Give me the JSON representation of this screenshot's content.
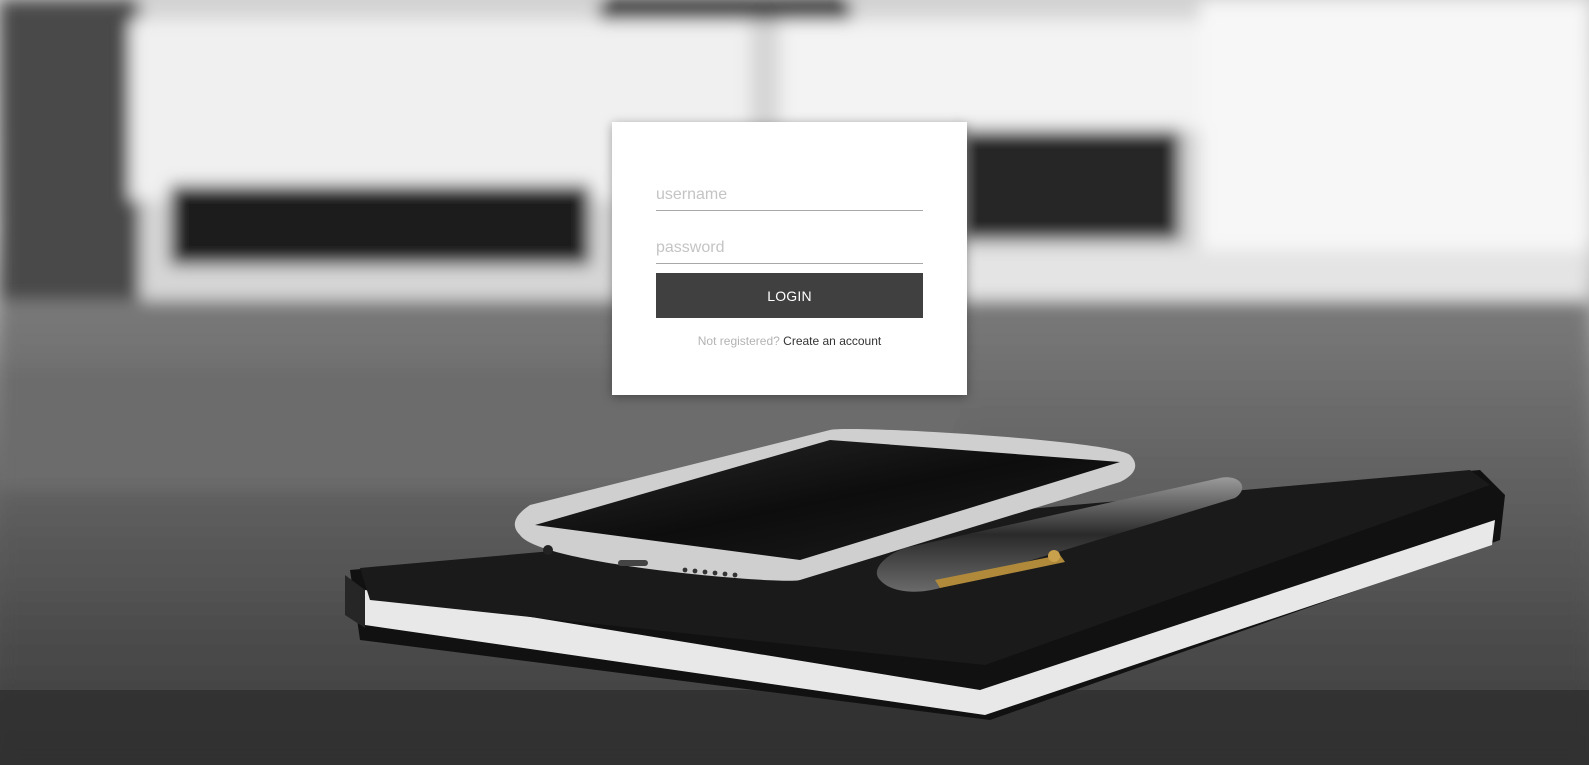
{
  "login_form": {
    "username_placeholder": "username",
    "password_placeholder": "password",
    "login_label": "LOGIN",
    "register_prompt": "Not registered?",
    "create_account_label": "Create an account"
  },
  "colors": {
    "button_background": "#404040",
    "button_text": "#ffffff",
    "card_background": "#ffffff",
    "prompt_text": "#b3b3b3",
    "link_text": "#333333"
  },
  "background": {
    "description_icons": [
      "desk-photo",
      "smartphone",
      "notebook",
      "pen",
      "keyboard"
    ]
  }
}
